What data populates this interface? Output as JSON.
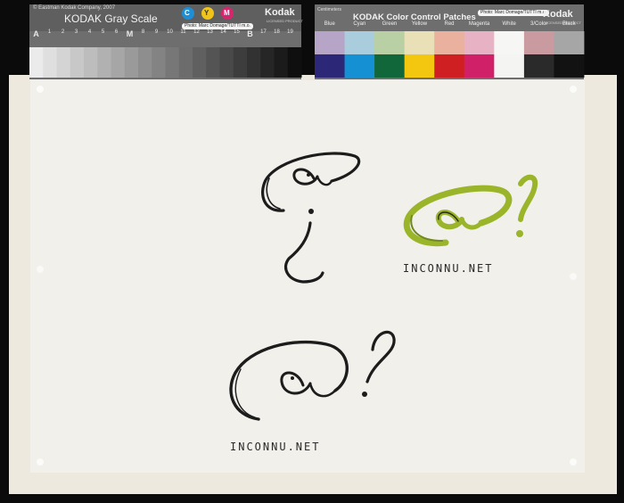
{
  "gray_card": {
    "title": "KODAK Gray Scale",
    "brand": "Kodak",
    "brand_sub": "LICENSED PRODUCT",
    "copyright": "© Eastman Kodak Company, 2007",
    "sticker": "Photo: Marc Domage/TUTTI m.o.",
    "cmy": [
      "C",
      "Y",
      "M"
    ],
    "scale_labels": [
      "A",
      "1",
      "2",
      "3",
      "4",
      "5",
      "6",
      "M",
      "8",
      "9",
      "10",
      "11",
      "12",
      "13",
      "14",
      "15",
      "B",
      "17",
      "18",
      "19"
    ]
  },
  "color_card": {
    "title": "KODAK Color Control Patches",
    "brand": "Kodak",
    "brand_sub": "LICENSED PRODUCT",
    "sticker": "Photo: Marc Domage/TUTTI m.o.",
    "corner": "Centimeters",
    "patch_labels": [
      "Blue",
      "Cyan",
      "Green",
      "Yellow",
      "Red",
      "Magenta",
      "White",
      "3/Color",
      "Black"
    ]
  },
  "drawing": {
    "caption_right": "INCONNU.NET",
    "caption_bottom": "INCONNU.NET"
  },
  "colors": {
    "background": "#0b0b0b",
    "paper": "#f2f0eb",
    "ink": "#1c1c1c",
    "green_ink": "#9ab52a"
  }
}
